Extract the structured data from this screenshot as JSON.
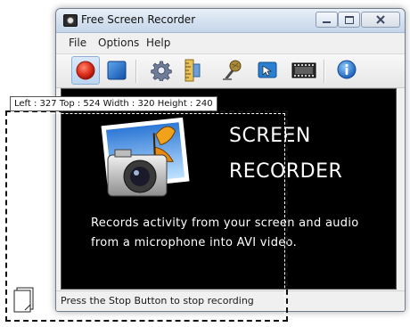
{
  "window": {
    "title": "Free Screen Recorder"
  },
  "menu": [
    "File",
    "Options",
    "Help"
  ],
  "toolbar": {
    "buttons": [
      {
        "name": "record-button",
        "icon": "record-icon",
        "pressed": true
      },
      {
        "name": "stop-button",
        "icon": "stop-icon"
      },
      {
        "name": "settings-button",
        "icon": "gear-icon"
      },
      {
        "name": "region-button",
        "icon": "ruler-icon"
      },
      {
        "name": "microphone-button",
        "icon": "microphone-icon"
      },
      {
        "name": "cursor-button",
        "icon": "cursor-icon"
      },
      {
        "name": "film-button",
        "icon": "film-icon"
      },
      {
        "name": "about-button",
        "icon": "info-icon"
      }
    ]
  },
  "content": {
    "logo_line1": "SCREEN",
    "logo_line2": "RECORDER",
    "description_line1": "Records activity from your screen and audio",
    "description_line2": "from a microphone into AVI video."
  },
  "status": "Press the Stop Button to stop recording",
  "region_tooltip": "Left : 327  Top : 524  Width : 320  Height : 240",
  "colors": {
    "record_red": "#e0301e",
    "stop_blue": "#1f74d6",
    "content_bg": "#000000",
    "title_gradient": "#d3e0ef"
  }
}
